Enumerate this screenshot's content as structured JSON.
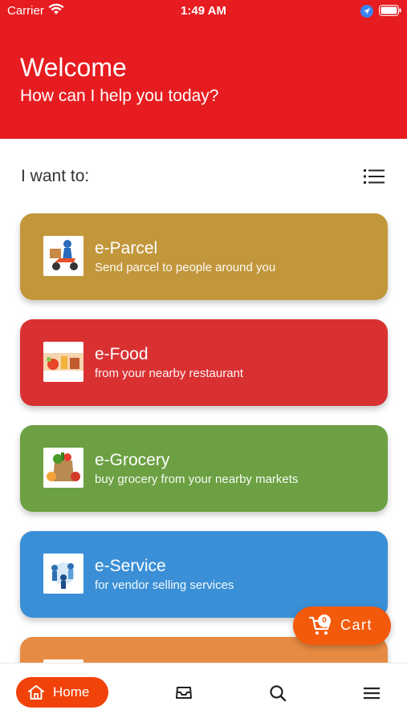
{
  "status_bar": {
    "carrier": "Carrier",
    "time": "1:49 AM"
  },
  "header": {
    "title": "Welcome",
    "subtitle": "How can I help you today?"
  },
  "section": {
    "label": "I want to:"
  },
  "services": [
    {
      "title": "e-Parcel",
      "description": "Send parcel to people around you",
      "color": "#c2973b",
      "icon": "delivery-scooter-icon"
    },
    {
      "title": "e-Food",
      "description": "from your nearby restaurant",
      "color": "#d93132",
      "icon": "food-icon"
    },
    {
      "title": "e-Grocery",
      "description": "buy grocery from your nearby markets",
      "color": "#6ca042",
      "icon": "grocery-bag-icon"
    },
    {
      "title": "e-Service",
      "description": "for vendor selling services",
      "color": "#3a8fd6",
      "icon": "service-people-icon"
    },
    {
      "title": "",
      "description": "",
      "color": "#e88b42",
      "icon": ""
    }
  ],
  "cart": {
    "count": "0",
    "label": "Cart"
  },
  "nav": {
    "home_label": "Home"
  },
  "colors": {
    "header": "#e61c20",
    "accent": "#f14209",
    "cart": "#f45a0c"
  }
}
